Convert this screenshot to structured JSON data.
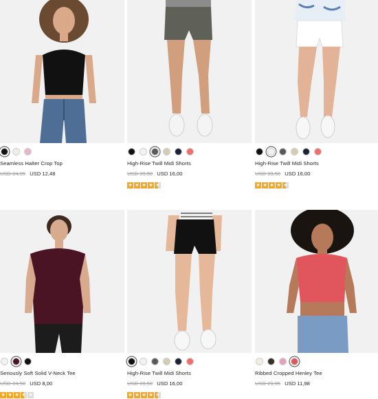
{
  "colors": {
    "star": "#f5a623",
    "star_empty": "#dcdcdc",
    "old_price": "#9a9a9a"
  },
  "products": [
    {
      "title": "Seamless Halter Crop Top",
      "old_price": "USD 24,95",
      "new_price": "USD 12,48",
      "swatches": [
        "#111111",
        "#efeee6",
        "#e3b8c8"
      ],
      "selected": 0,
      "rating": null
    },
    {
      "title": "High-Rise Twill Midi Shorts",
      "old_price": "USD 39,50",
      "new_price": "USD 16,00",
      "swatches": [
        "#111111",
        "#f2f2f2",
        "#5a5a5a",
        "#d7cbb2",
        "#1b2338",
        "#ef6f6a"
      ],
      "selected": 2,
      "rating": 4.5
    },
    {
      "title": "High-Rise Twill Midi Shorts",
      "old_price": "USD 39,50",
      "new_price": "USD 16,00",
      "swatches": [
        "#111111",
        "#f2f2f2",
        "#5a5a5a",
        "#d7cbb2",
        "#1b2338",
        "#ef6f6a"
      ],
      "selected": 1,
      "rating": 4.5
    },
    {
      "title": "Seriously Soft Solid V-Neck Tee",
      "old_price": "USD 24,50",
      "new_price": "USD 8,00",
      "swatches": [
        "#f2f2f2",
        "#4a1424",
        "#111111"
      ],
      "selected": 1,
      "rating": 3.5
    },
    {
      "title": "High-Rise Twill Midi Shorts",
      "old_price": "USD 39,50",
      "new_price": "USD 16,00",
      "swatches": [
        "#111111",
        "#f2f2f2",
        "#5a5a5a",
        "#d7cbb2",
        "#1b2338",
        "#ef6f6a"
      ],
      "selected": 0,
      "rating": 4.5
    },
    {
      "title": "Ribbed Cropped Henley Tee",
      "old_price": "USD 29,95",
      "new_price": "USD 11,98",
      "swatches": [
        "#f3eee4",
        "#3a3020",
        "#e8a0b8",
        "#e0565c"
      ],
      "selected": 3,
      "rating": null
    }
  ]
}
